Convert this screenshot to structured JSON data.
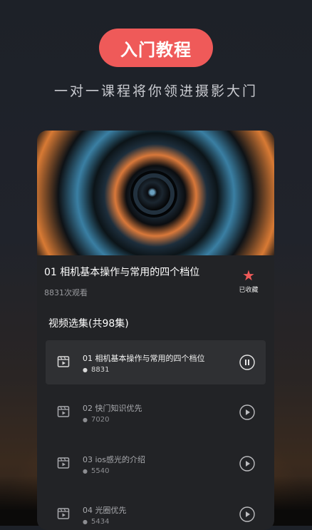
{
  "header": {
    "pill_label": "入门教程",
    "subtitle": "一对一课程将你领进摄影大门"
  },
  "video": {
    "title": "01 相机基本操作与常用的四个档位",
    "views": "8831次观看",
    "favorite_label": "已收藏"
  },
  "playlist": {
    "title": "视频选集(共98集)",
    "episodes": [
      {
        "title": "01 相机基本操作与常用的四个档位",
        "count": "8831",
        "state": "playing"
      },
      {
        "title": "02 快门知识优先",
        "count": "7020",
        "state": "paused"
      },
      {
        "title": "03 ios感光的介绍",
        "count": "5540",
        "state": "paused"
      },
      {
        "title": "04 光圈优先",
        "count": "5434",
        "state": "paused"
      }
    ]
  },
  "colors": {
    "accent": "#ef5a59",
    "card": "#222326",
    "active_row": "#2f3033"
  },
  "icons": [
    "video-file-icon",
    "person-icon",
    "pause-icon",
    "play-icon",
    "star-icon"
  ]
}
